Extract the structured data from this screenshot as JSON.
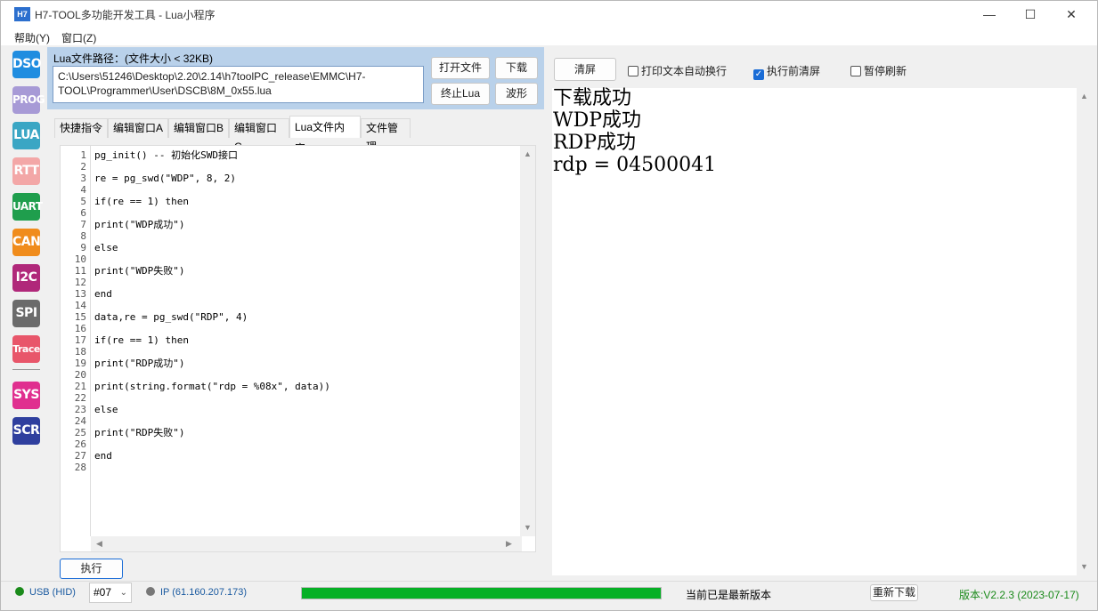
{
  "window": {
    "title": "H7-TOOL多功能开发工具 - Lua小程序",
    "icon_text": "H7"
  },
  "menu": {
    "help": "帮助(Y)",
    "window": "窗口(Z)"
  },
  "sidebar": [
    {
      "label": "DSO",
      "color": "#1f8de0"
    },
    {
      "label": "PROG",
      "color": "#a79ad6"
    },
    {
      "label": "LUA",
      "color": "#3aa6c4"
    },
    {
      "label": "RTT",
      "color": "#f3a7a7"
    },
    {
      "label": "UART",
      "color": "#1f9e4d"
    },
    {
      "label": "CAN",
      "color": "#f08c1c"
    },
    {
      "label": "I2C",
      "color": "#b0287a"
    },
    {
      "label": "SPI",
      "color": "#6b6b6b"
    },
    {
      "label": "Trace",
      "color": "#e8566a"
    },
    {
      "label": "SYS",
      "color": "#e02f8f"
    },
    {
      "label": "SCR",
      "color": "#2f3f9e"
    }
  ],
  "file": {
    "label": "Lua文件路径：(文件大小 < 32KB)",
    "path_line1": "C:\\Users\\51246\\Desktop\\2.20\\2.14\\h7toolPC_release\\EMMC\\H7-",
    "path_line2": "TOOL\\Programmer\\User\\DSCB\\8M_0x55.lua",
    "open_btn": "打开文件",
    "download_btn": "下载",
    "stop_btn": "终止Lua",
    "wave_btn": "波形"
  },
  "tabs": [
    "快捷指令",
    "编辑窗口A",
    "编辑窗口B",
    "编辑窗口C",
    "Lua文件内容",
    "文件管理"
  ],
  "active_tab": 4,
  "code_lines": [
    "pg_init() -- 初始化SWD接口",
    "",
    "re = pg_swd(\"WDP\", 8, 2)",
    "",
    "if(re == 1) then",
    "",
    "print(\"WDP成功\")",
    "",
    "else",
    "",
    "print(\"WDP失败\")",
    "",
    "end",
    "",
    "data,re = pg_swd(\"RDP\", 4)",
    "",
    "if(re == 1) then",
    "",
    "print(\"RDP成功\")",
    "",
    "print(string.format(\"rdp = %08x\", data))",
    "",
    "else",
    "",
    "print(\"RDP失败\")",
    "",
    "end",
    ""
  ],
  "execute_btn": "执行",
  "right": {
    "clear_btn": "清屏",
    "opt_wrap": "打印文本自动换行",
    "opt_wrap_checked": false,
    "opt_clear": "执行前清屏",
    "opt_clear_checked": true,
    "opt_pause": "暂停刷新",
    "opt_pause_checked": false
  },
  "output_lines": [
    "下载成功",
    "WDP成功",
    "RDP成功",
    "rdp = 04500041"
  ],
  "status": {
    "usb": "USB (HID)",
    "usb_color": "#1a8a1a",
    "port": "#07",
    "ip": "IP (61.160.207.173)",
    "ip_color": "#777777",
    "progress_percent": 100,
    "version_msg": "当前已是最新版本",
    "redownload_btn": "重新下载",
    "version": "版本:V2.2.3 (2023-07-17)",
    "version_color": "#1a8a1a"
  }
}
